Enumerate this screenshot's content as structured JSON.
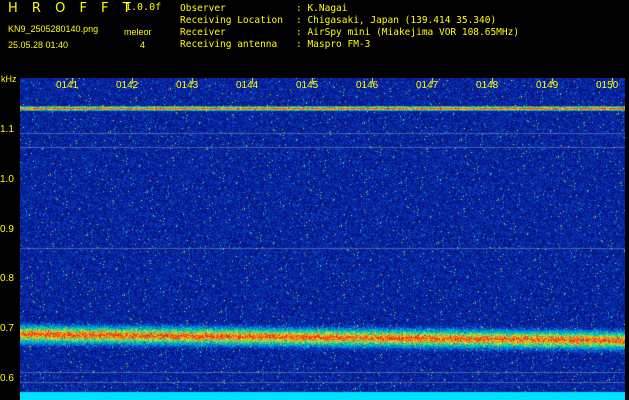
{
  "header": {
    "title": "H R O F F T",
    "version": "1.0.0f",
    "filename": "KN9_2505280140.png",
    "mode": "meleor",
    "channel": "4",
    "datetime": "25.05.28 01:40"
  },
  "info": [
    {
      "key": "Observer",
      "value": ": K.Nagai"
    },
    {
      "key": "Receiving Location",
      "value": ": Chigasaki, Japan (139.414 35.340)"
    },
    {
      "key": "Receiver",
      "value": ": AirSpy mini (Miakejima VOR 108.65MHz)"
    },
    {
      "key": "Receiving antenna",
      "value": ": Maspro FM-3"
    }
  ],
  "axis": {
    "unit": "kHz",
    "y_ticks": [
      "1.1",
      "1.0",
      "0.9",
      "0.8",
      "0.7",
      "0.6"
    ],
    "x_ticks": [
      "0141",
      "0142",
      "0143",
      "0144",
      "0145",
      "0146",
      "0147",
      "0148",
      "0149",
      "0150"
    ]
  },
  "colors": {
    "label": "#ffff00",
    "background": "#000000",
    "noise": "#0a1a8c",
    "band": "#ff3030",
    "baseline": "#00e0ff"
  }
}
